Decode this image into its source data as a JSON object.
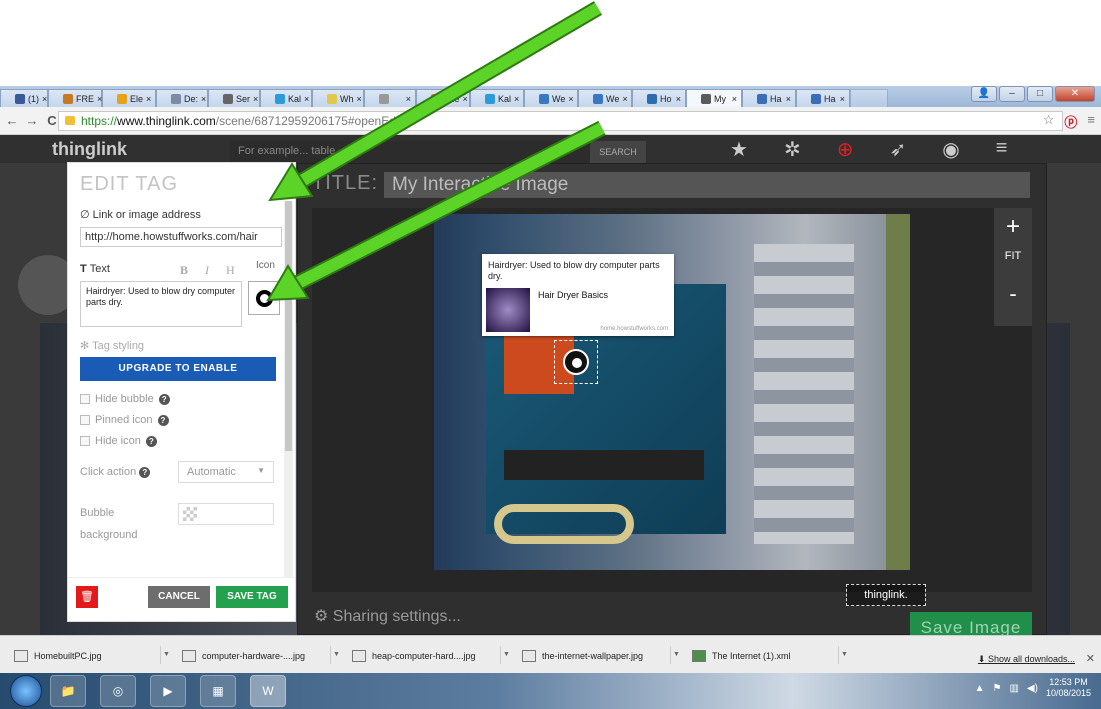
{
  "browser": {
    "tabs": [
      {
        "label": "(1)",
        "fav": "#3b5998"
      },
      {
        "label": "FRE",
        "fav": "#c47a22"
      },
      {
        "label": "Ele",
        "fav": "#e8a21a"
      },
      {
        "label": "De:",
        "fav": "#7a8ba3"
      },
      {
        "label": "Ser",
        "fav": "#666"
      },
      {
        "label": "Kal",
        "fav": "#2c9cd8"
      },
      {
        "label": "Wh",
        "fav": "#e0c84a"
      },
      {
        "label": "",
        "fav": "#999"
      },
      {
        "label": "The",
        "fav": "#e0762a"
      },
      {
        "label": "Kal",
        "fav": "#2c9cd8"
      },
      {
        "label": "We",
        "fav": "#3a78c2"
      },
      {
        "label": "We",
        "fav": "#3a78c2"
      },
      {
        "label": "Ho",
        "fav": "#2a6db0"
      },
      {
        "label": "My",
        "fav": "#5a5a5a"
      },
      {
        "label": "Ha",
        "fav": "#3a6fb7"
      },
      {
        "label": "Ha",
        "fav": "#3a6fb7"
      }
    ],
    "url_https": "https://",
    "url_host": "www.thinglink.com",
    "url_path": "/scene/6871295920617",
    "url_hash": "5#openEditor"
  },
  "site": {
    "logo": "thinglink",
    "search_placeholder": "For example... table",
    "search_button": "SEARCH"
  },
  "editor": {
    "title_label": "TITLE:",
    "title_value": "My Interactive Image",
    "zoom_in": "+",
    "fit": "FIT",
    "zoom_out": "-",
    "watermark": "thinglink.",
    "sharing": "Sharing settings...",
    "save_image": "Save Image"
  },
  "bubble": {
    "text": "Hairdryer: Used to blow dry computer parts dry.",
    "link_title": "Hair Dryer Basics",
    "source": "home.howstuffworks.com"
  },
  "panel": {
    "title": "EDIT TAG",
    "link_label": "Link or image address",
    "link_value": "http://home.howstuffworks.com/hair",
    "text_label": "Text",
    "bold": "B",
    "italic": "I",
    "heading": "H",
    "icon_label": "Icon",
    "text_value": "Hairdryer: Used to blow dry computer parts dry.",
    "tag_styling": "Tag styling",
    "upgrade": "UPGRADE TO ENABLE",
    "hide_bubble": "Hide bubble",
    "pinned_icon": "Pinned icon",
    "hide_icon": "Hide icon",
    "click_action": "Click action",
    "click_action_value": "Automatic",
    "bubble_background_1": "Bubble",
    "bubble_background_2": "background",
    "cancel": "CANCEL",
    "save_tag": "SAVE TAG"
  },
  "downloads": {
    "items": [
      "HomebuiltPC.jpg",
      "computer-hardware-....jpg",
      "heap-computer-hard....jpg",
      "the-internet-wallpaper.jpg",
      "The Internet (1).xml"
    ],
    "show_all": "Show all downloads..."
  },
  "taskbar": {
    "time": "12:53 PM",
    "date": "10/08/2015"
  },
  "colors": {
    "accent_blue": "#1a5bb5",
    "save_green": "#24a14e",
    "delete_red": "#e21a1a",
    "arrow_green": "#5bd427"
  }
}
